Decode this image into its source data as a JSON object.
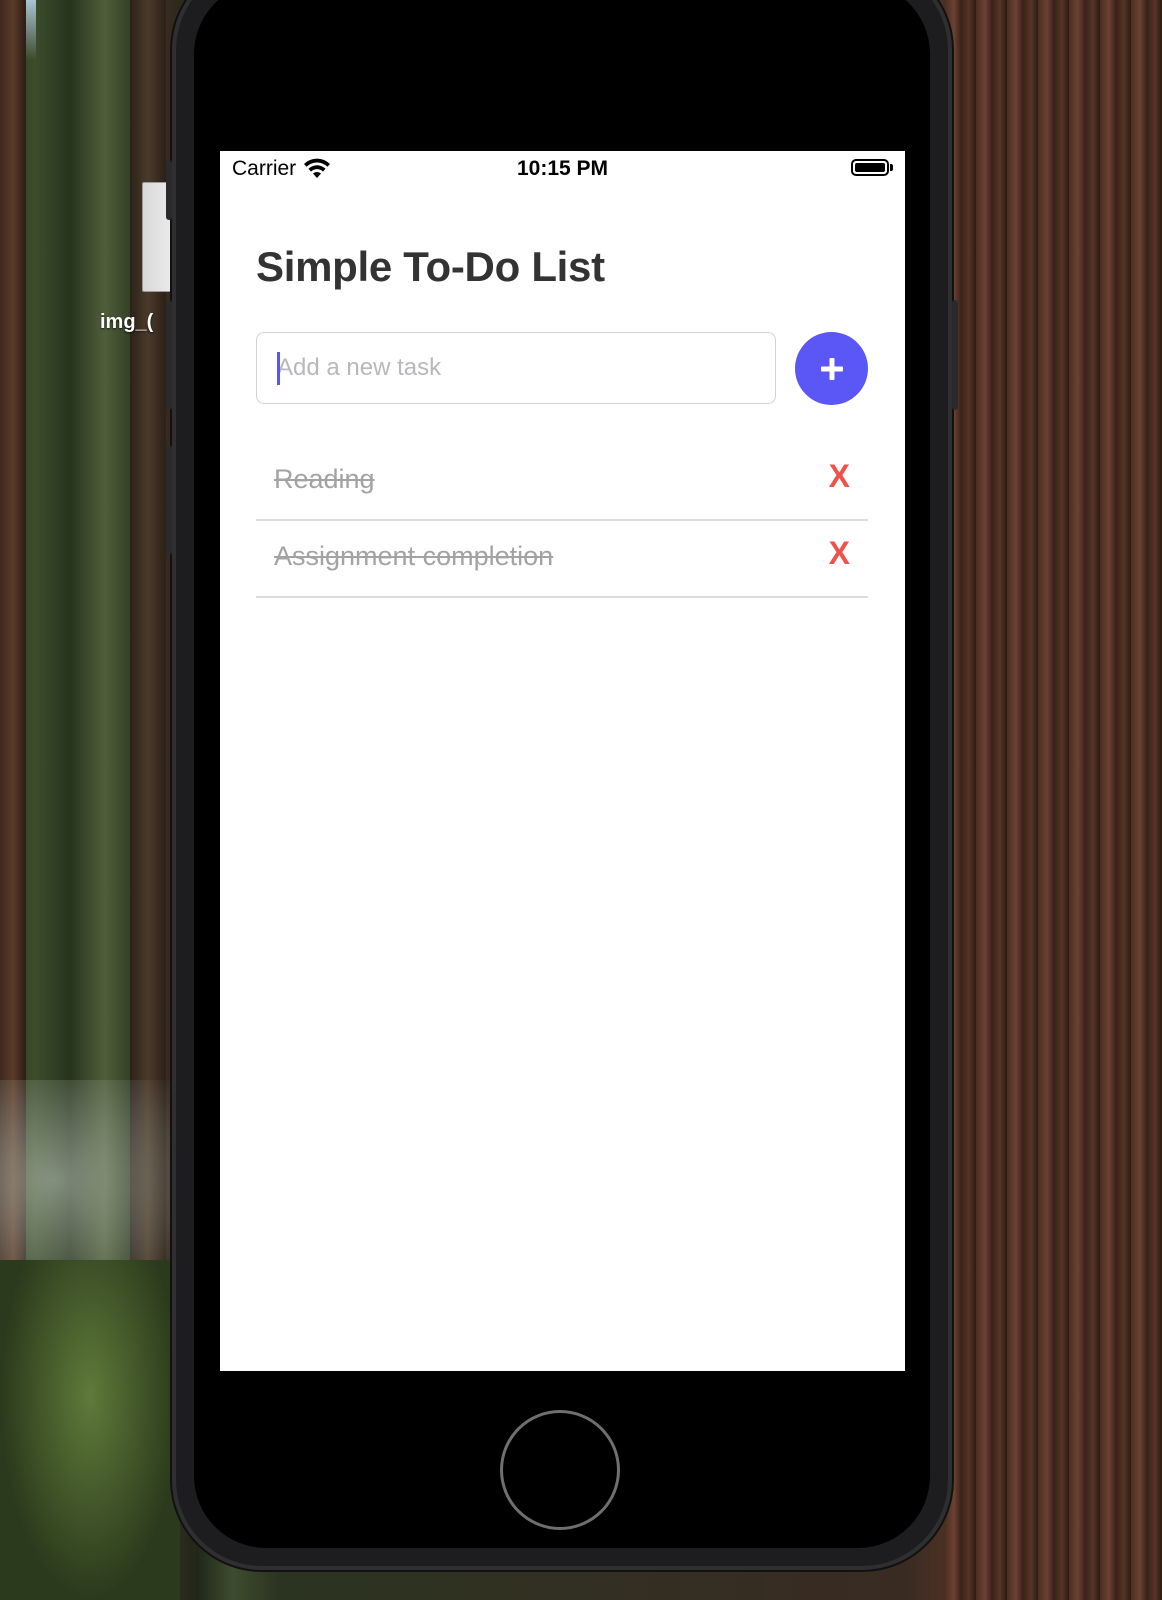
{
  "desktop": {
    "file_label": "img_("
  },
  "status_bar": {
    "carrier": "Carrier",
    "time": "10:15 PM"
  },
  "app": {
    "title": "Simple To-Do List",
    "input": {
      "value": "",
      "placeholder": "Add a new task"
    },
    "add_button_icon": "plus-icon",
    "accent_color": "#5b56f6",
    "delete_color": "#f1514b",
    "tasks": [
      {
        "text": "Reading",
        "completed": true,
        "delete_label": "X"
      },
      {
        "text": "Assignment completion",
        "completed": true,
        "delete_label": "X"
      }
    ]
  }
}
